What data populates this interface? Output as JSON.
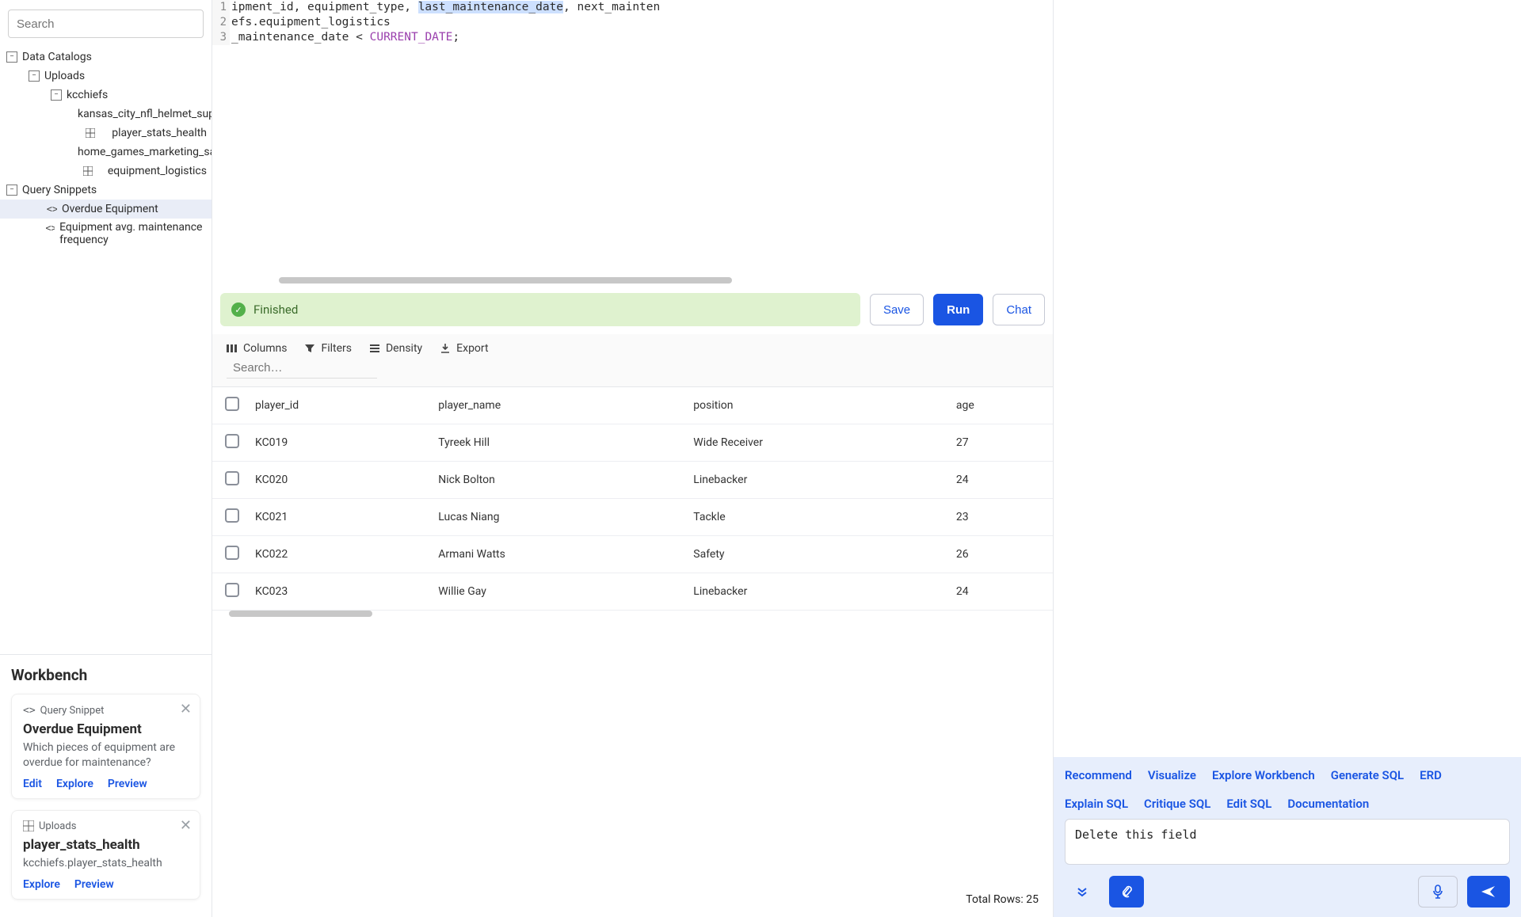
{
  "sidebar": {
    "search_placeholder": "Search",
    "tree": {
      "data_catalogs_label": "Data Catalogs",
      "uploads_label": "Uploads",
      "kcchiefs_label": "kcchiefs",
      "tables": [
        "kansas_city_nfl_helmet_supp",
        "player_stats_health",
        "home_games_marketing_sal",
        "equipment_logistics"
      ],
      "query_snippets_label": "Query Snippets",
      "snippets": [
        "Overdue Equipment",
        "Equipment avg. maintenance frequency"
      ]
    }
  },
  "workbench": {
    "title": "Workbench",
    "cards": [
      {
        "tag": "Query Snippet",
        "name": "Overdue Equipment",
        "desc": "Which pieces of equipment are overdue for maintenance?",
        "actions": [
          "Edit",
          "Explore",
          "Preview"
        ]
      },
      {
        "tag": "Uploads",
        "name": "player_stats_health",
        "desc": "kcchiefs.player_stats_health",
        "actions": [
          "Explore",
          "Preview"
        ]
      }
    ]
  },
  "editor": {
    "lines": [
      {
        "prefix": "ipment_id, equipment_type, ",
        "highlight": "last_maintenance_date",
        "suffix": ", next_mainten"
      },
      {
        "text": "efs.equipment_logistics"
      },
      {
        "prefix": "_maintenance_date < ",
        "kw": "CURRENT_DATE",
        "suffix": ";"
      }
    ]
  },
  "runbar": {
    "status": "Finished",
    "save": "Save",
    "run": "Run",
    "chat": "Chat"
  },
  "toolbar": {
    "columns": "Columns",
    "filters": "Filters",
    "density": "Density",
    "export": "Export",
    "search_placeholder": "Search…"
  },
  "table": {
    "headers": [
      "player_id",
      "player_name",
      "position",
      "age"
    ],
    "rows": [
      [
        "KC019",
        "Tyreek Hill",
        "Wide Receiver",
        "27"
      ],
      [
        "KC020",
        "Nick Bolton",
        "Linebacker",
        "24"
      ],
      [
        "KC021",
        "Lucas Niang",
        "Tackle",
        "23"
      ],
      [
        "KC022",
        "Armani Watts",
        "Safety",
        "26"
      ],
      [
        "KC023",
        "Willie Gay",
        "Linebacker",
        "24"
      ]
    ],
    "footer": "Total Rows: 25"
  },
  "right": {
    "chips": [
      "Recommend",
      "Visualize",
      "Explore Workbench",
      "Generate SQL",
      "ERD",
      "Explain SQL",
      "Critique SQL",
      "Edit SQL",
      "Documentation"
    ],
    "prompt_value": "Delete this field"
  }
}
